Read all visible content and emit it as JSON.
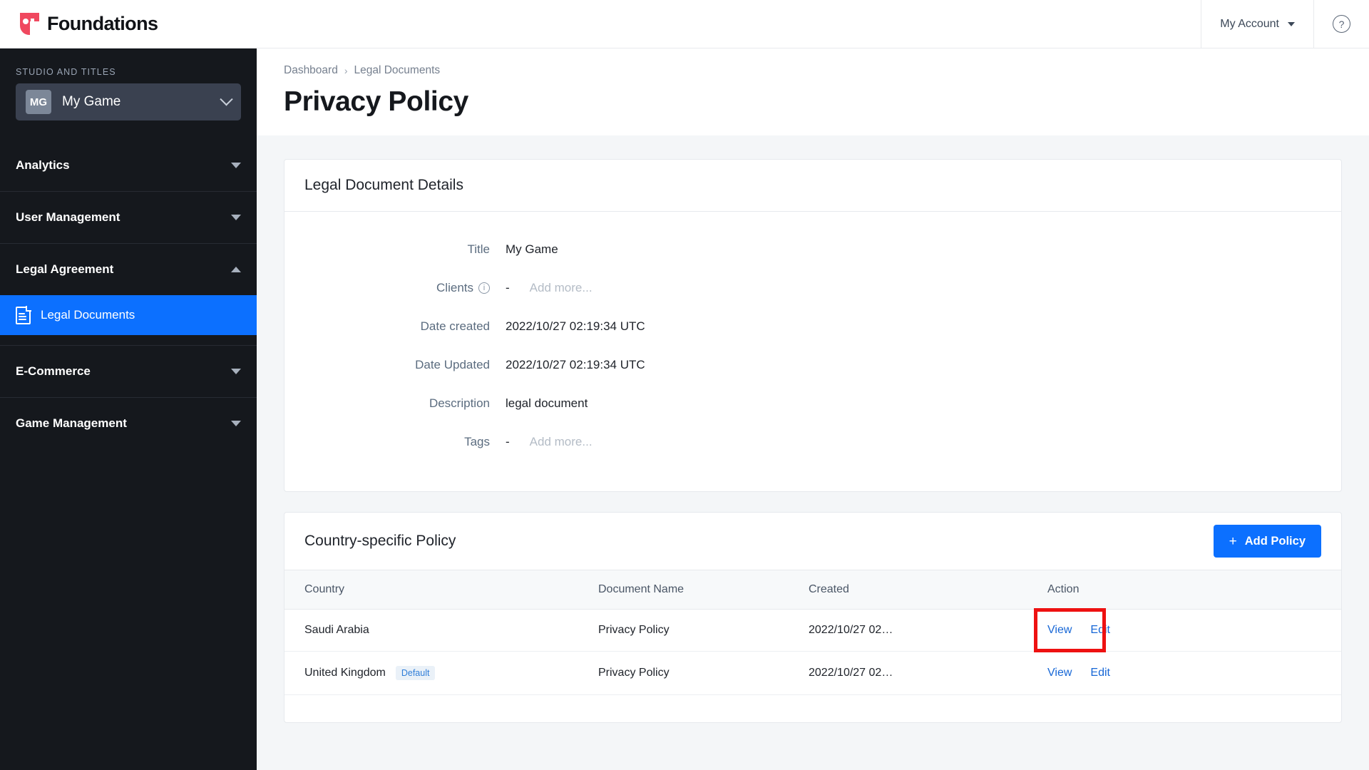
{
  "topbar": {
    "brand": "Foundations",
    "account_label": "My Account",
    "account_caret_icon": "chevron-down-icon",
    "help_icon": "question-mark-icon",
    "help_glyph": "?"
  },
  "sidebar": {
    "studio_section_label": "STUDIO AND TITLES",
    "studio": {
      "initials": "MG",
      "name": "My Game",
      "chevron_icon": "chevron-down-icon"
    },
    "sections": [
      {
        "label": "Analytics",
        "state": "collapsed",
        "icon": "triangle-down-icon"
      },
      {
        "label": "User Management",
        "state": "collapsed",
        "icon": "triangle-down-icon"
      },
      {
        "label": "Legal Agreement",
        "state": "expanded",
        "icon": "triangle-up-icon"
      },
      {
        "label": "E-Commerce",
        "state": "collapsed",
        "icon": "triangle-down-icon"
      },
      {
        "label": "Game Management",
        "state": "collapsed",
        "icon": "triangle-down-icon"
      }
    ],
    "legal_sub_item": {
      "label": "Legal Documents",
      "icon": "document-icon",
      "active": true
    }
  },
  "page": {
    "breadcrumb": [
      "Dashboard",
      "Legal Documents"
    ],
    "breadcrumb_separator": "›",
    "title": "Privacy Policy"
  },
  "details_card": {
    "title": "Legal Document Details",
    "fields": [
      {
        "label": "Title",
        "value": "My Game",
        "has_info": false,
        "dash": "",
        "placeholder": ""
      },
      {
        "label": "Clients",
        "value": "",
        "has_info": true,
        "dash": "-",
        "placeholder": "Add more..."
      },
      {
        "label": "Date created",
        "value": "2022/10/27 02:19:34 UTC",
        "has_info": false,
        "dash": "",
        "placeholder": ""
      },
      {
        "label": "Date Updated",
        "value": "2022/10/27 02:19:34 UTC",
        "has_info": false,
        "dash": "",
        "placeholder": ""
      },
      {
        "label": "Description",
        "value": "legal document",
        "has_info": false,
        "dash": "",
        "placeholder": ""
      },
      {
        "label": "Tags",
        "value": "",
        "has_info": true,
        "dash": "-",
        "placeholder": "Add more..."
      }
    ]
  },
  "policy_card": {
    "title": "Country-specific Policy",
    "add_button": {
      "label": "Add Policy",
      "plus_icon": "plus-icon",
      "color": "#0c70ff"
    },
    "columns": [
      "Country",
      "Document Name",
      "Created",
      "Action"
    ],
    "rows": [
      {
        "country": "Saudi Arabia",
        "badge": "",
        "document_name": "Privacy Policy",
        "created": "2022/10/27 02…",
        "view_label": "View",
        "edit_label": "Edit",
        "highlighted": true
      },
      {
        "country": "United Kingdom",
        "badge": "Default",
        "document_name": "Privacy Policy",
        "created": "2022/10/27 02…",
        "view_label": "View",
        "edit_label": "Edit",
        "highlighted": false
      }
    ]
  },
  "colors": {
    "accent_blue": "#0c70ff",
    "link_blue": "#1767d6",
    "brand_red": "#f0485f",
    "sidebar_bg": "#15181d",
    "content_bg": "#f4f6f8",
    "highlight_red": "#ee1111"
  }
}
